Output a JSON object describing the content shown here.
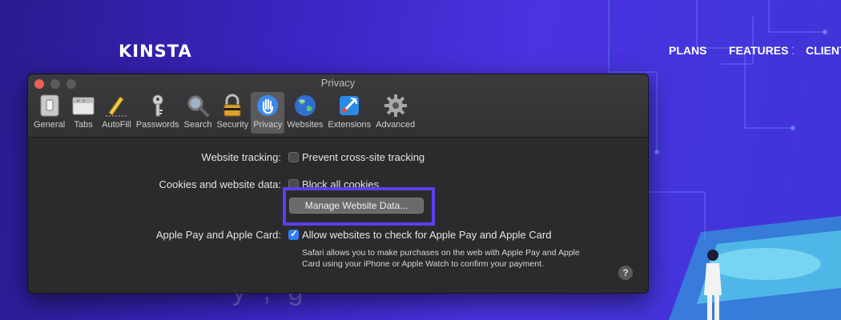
{
  "site": {
    "logo": "KINSTA",
    "nav": [
      "PLANS",
      "FEATURES",
      "CLIENT"
    ],
    "bg_fragment": "y   ,   g"
  },
  "window": {
    "title": "Privacy",
    "toolbar": [
      {
        "label": "General",
        "icon": "general-switch-icon"
      },
      {
        "label": "Tabs",
        "icon": "tabs-icon"
      },
      {
        "label": "AutoFill",
        "icon": "pencil-icon"
      },
      {
        "label": "Passwords",
        "icon": "key-icon"
      },
      {
        "label": "Search",
        "icon": "magnifier-icon"
      },
      {
        "label": "Security",
        "icon": "lock-icon"
      },
      {
        "label": "Privacy",
        "icon": "hand-icon",
        "active": true
      },
      {
        "label": "Websites",
        "icon": "globe-icon"
      },
      {
        "label": "Extensions",
        "icon": "puzzle-icon"
      },
      {
        "label": "Advanced",
        "icon": "gear-icon"
      }
    ],
    "website_tracking": {
      "label": "Website tracking:",
      "option": "Prevent cross-site tracking",
      "checked": false
    },
    "cookies": {
      "label": "Cookies and website data:",
      "option": "Block all cookies",
      "checked": false
    },
    "manage_button": "Manage Website Data...",
    "apple_pay": {
      "label": "Apple Pay and Apple Card:",
      "option": "Allow websites to check for Apple Pay and Apple Card",
      "checked": true
    },
    "note": "Safari allows you to make purchases on the web with Apple Pay and Apple Card using your iPhone or Apple Watch to confirm your payment.",
    "help": "?"
  },
  "colors": {
    "highlight": "#5b3ff0",
    "checkbox_checked": "#2f7cf6",
    "close": "#ec5f56"
  }
}
